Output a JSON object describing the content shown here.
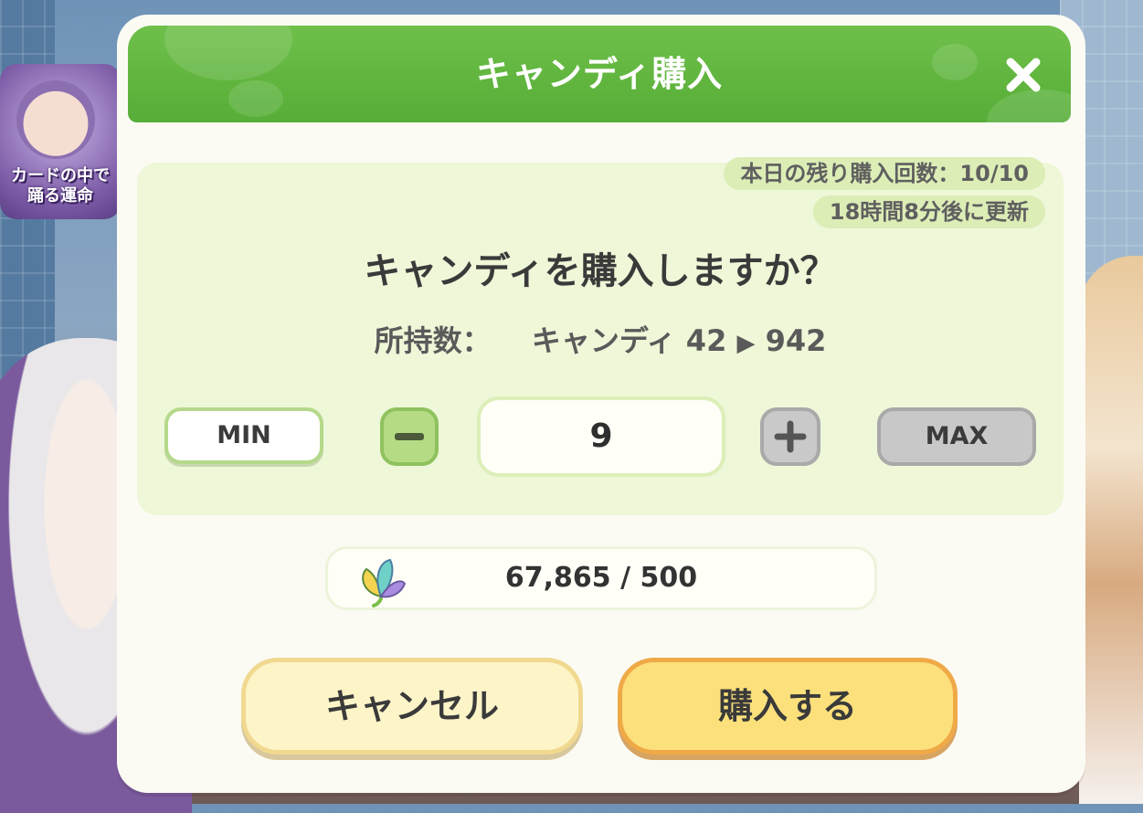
{
  "dialog": {
    "title": "キャンディ購入",
    "close_icon": "close-icon"
  },
  "info": {
    "remaining_purchases": "本日の残り購入回数：10/10",
    "reset_timer": "18時間8分後に更新"
  },
  "question": "キャンディを購入しますか？",
  "owned": {
    "label": "所持数：",
    "item": "キャンディ",
    "from": "42",
    "arrow": "▶",
    "to": "942"
  },
  "quantity": {
    "min_label": "MIN",
    "max_label": "MAX",
    "minus_icon": "minus-icon",
    "plus_icon": "plus-icon",
    "value": "9"
  },
  "cost": {
    "icon": "leaf-gem-icon",
    "text": "67,865 / 500"
  },
  "actions": {
    "cancel_label": "キャンセル",
    "buy_label": "購入する"
  },
  "background": {
    "banner_text": "カードの中で\n踊る運命"
  },
  "colors": {
    "header_green": "#5cb33d",
    "panel_green": "#eef7d8",
    "buy_button": "#fbe07b",
    "cancel_button": "#fdf4c8"
  }
}
